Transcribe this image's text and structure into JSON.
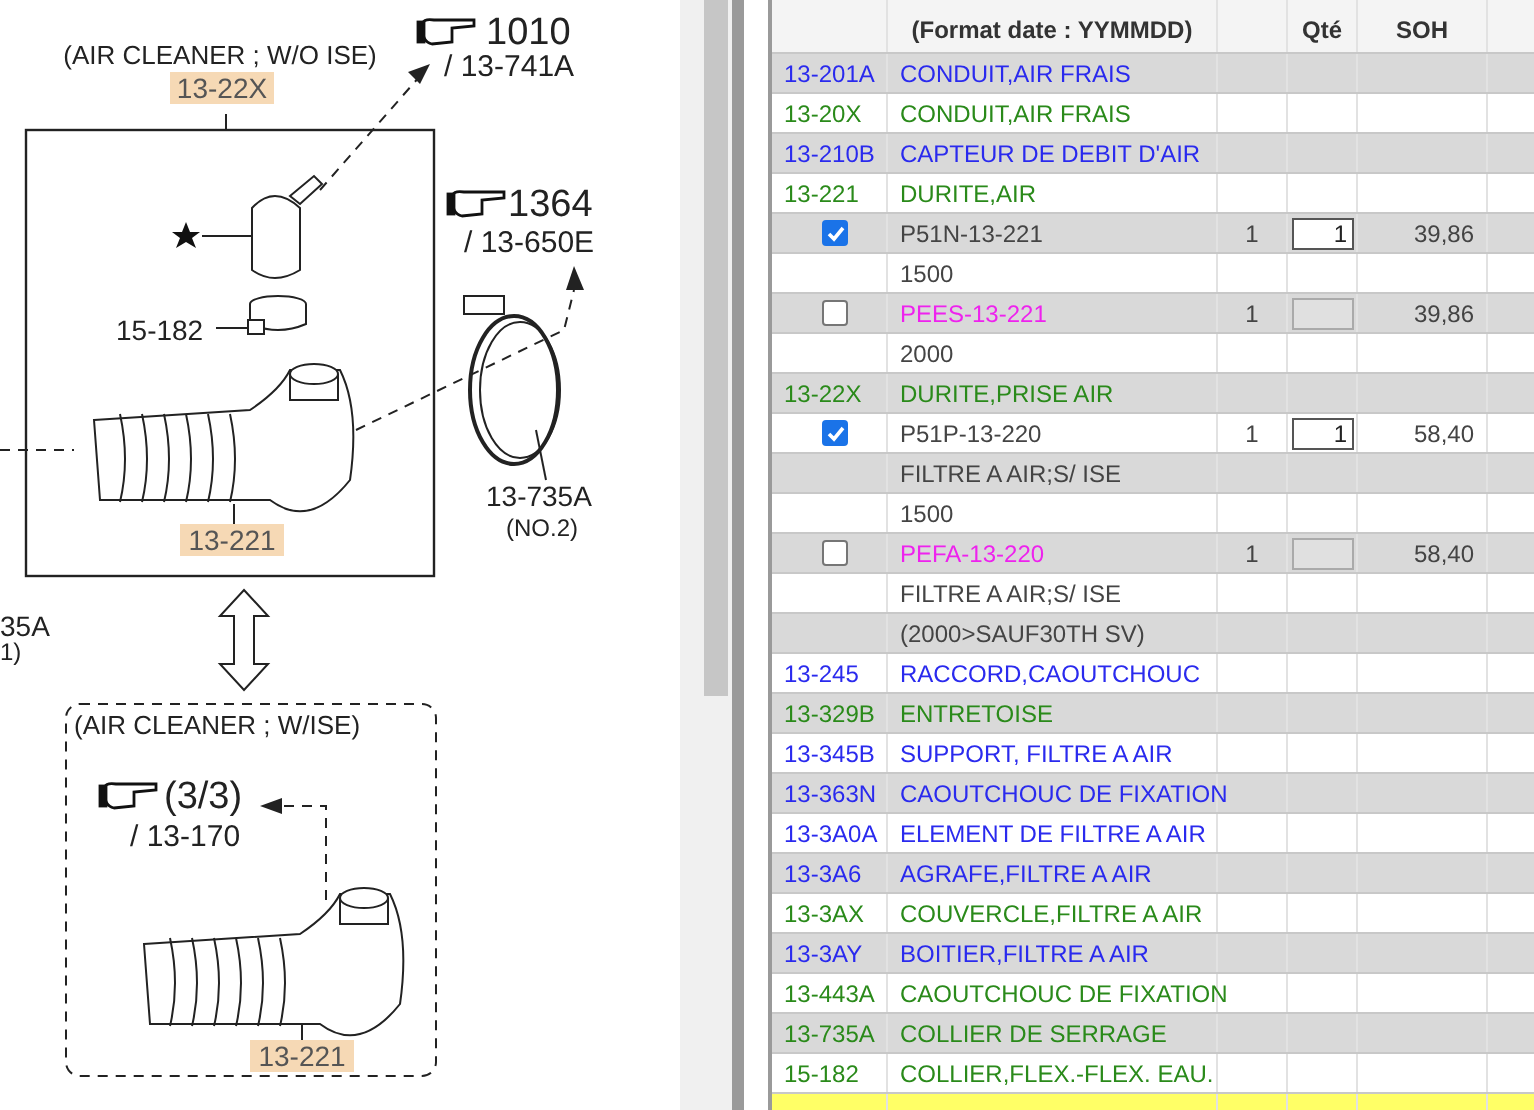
{
  "diagram": {
    "labels": [
      {
        "kind": "caption",
        "text": "(AIR CLEANER ; W/O ISE)"
      },
      {
        "kind": "highlight",
        "text": "13-22X"
      },
      {
        "kind": "ref_big",
        "text": "1010"
      },
      {
        "kind": "ref_small",
        "text": "/ 13-741A"
      },
      {
        "kind": "ref_big",
        "text": "1364"
      },
      {
        "kind": "ref_small",
        "text": "/ 13-650E"
      },
      {
        "kind": "plain",
        "text": "15-182"
      },
      {
        "kind": "highlight",
        "text": "13-221"
      },
      {
        "kind": "plain",
        "text": "13-735A"
      },
      {
        "kind": "small",
        "text": "(NO.2)"
      },
      {
        "kind": "plain",
        "text": "35A"
      },
      {
        "kind": "small",
        "text": "1)"
      },
      {
        "kind": "caption",
        "text": "(AIR CLEANER ; W/ISE)"
      },
      {
        "kind": "ref_big",
        "text": "(3/3)"
      },
      {
        "kind": "ref_small",
        "text": "/ 13-170"
      },
      {
        "kind": "highlight",
        "text": "13-221"
      }
    ]
  },
  "table": {
    "header": {
      "name_column": "(Format date : YYMMDD)",
      "order_qty_column": "Qté",
      "price_column": "SOH"
    },
    "rows": [
      {
        "kind": "group",
        "code": "13-201A",
        "name": "CONDUIT,AIR FRAIS",
        "color": "#2a2aee"
      },
      {
        "kind": "group",
        "code": "13-20X",
        "name": "CONDUIT,AIR FRAIS",
        "color": "#2a8a1a"
      },
      {
        "kind": "group",
        "code": "13-210B",
        "name": "CAPTEUR DE DEBIT D'AIR",
        "color": "#2a2aee"
      },
      {
        "kind": "group",
        "code": "13-221",
        "name": "DURITE,AIR",
        "color": "#2a8a1a"
      },
      {
        "kind": "part",
        "checked": true,
        "part_no": "P51N-13-221",
        "qty": "1",
        "order_qty": "1",
        "price": "39,86",
        "color": "#444444"
      },
      {
        "kind": "note",
        "text": "1500"
      },
      {
        "kind": "part",
        "checked": false,
        "part_no": "PEES-13-221",
        "qty": "1",
        "price": "39,86",
        "color": "#ee22ee"
      },
      {
        "kind": "note",
        "text": "2000"
      },
      {
        "kind": "group",
        "code": "13-22X",
        "name": "DURITE,PRISE AIR",
        "color": "#2a8a1a"
      },
      {
        "kind": "part",
        "checked": true,
        "part_no": "P51P-13-220",
        "qty": "1",
        "order_qty": "1",
        "price": "58,40",
        "color": "#444444"
      },
      {
        "kind": "note",
        "text": "FILTRE A AIR;S/ ISE"
      },
      {
        "kind": "note",
        "text": "1500"
      },
      {
        "kind": "part",
        "checked": false,
        "part_no": "PEFA-13-220",
        "qty": "1",
        "price": "58,40",
        "color": "#ee22ee"
      },
      {
        "kind": "note",
        "text": "FILTRE A AIR;S/ ISE"
      },
      {
        "kind": "note",
        "text": "(2000>SAUF30TH SV)"
      },
      {
        "kind": "group",
        "code": "13-245",
        "name": "RACCORD,CAOUTCHOUC",
        "color": "#2a2aee"
      },
      {
        "kind": "group",
        "code": "13-329B",
        "name": "ENTRETOISE",
        "color": "#2a8a1a"
      },
      {
        "kind": "group",
        "code": "13-345B",
        "name": "SUPPORT, FILTRE A AIR",
        "color": "#2a2aee"
      },
      {
        "kind": "group",
        "code": "13-363N",
        "name": "CAOUTCHOUC DE FIXATION",
        "color": "#2a2aee"
      },
      {
        "kind": "group",
        "code": "13-3A0A",
        "name": "ELEMENT DE FILTRE A AIR",
        "color": "#2a2aee"
      },
      {
        "kind": "group",
        "code": "13-3A6",
        "name": "AGRAFE,FILTRE A AIR",
        "color": "#2a2aee"
      },
      {
        "kind": "group",
        "code": "13-3AX",
        "name": "COUVERCLE,FILTRE A AIR",
        "color": "#2a8a1a"
      },
      {
        "kind": "group",
        "code": "13-3AY",
        "name": "BOITIER,FILTRE A AIR",
        "color": "#2a2aee"
      },
      {
        "kind": "group",
        "code": "13-443A",
        "name": "CAOUTCHOUC DE FIXATION",
        "color": "#2a8a1a"
      },
      {
        "kind": "group",
        "code": "13-735A",
        "name": "COLLIER DE SERRAGE",
        "color": "#2a8a1a"
      },
      {
        "kind": "group",
        "code": "15-182",
        "name": "COLLIER,FLEX.-FLEX. EAU.",
        "color": "#2a8a1a"
      },
      {
        "kind": "highlighted"
      }
    ]
  }
}
